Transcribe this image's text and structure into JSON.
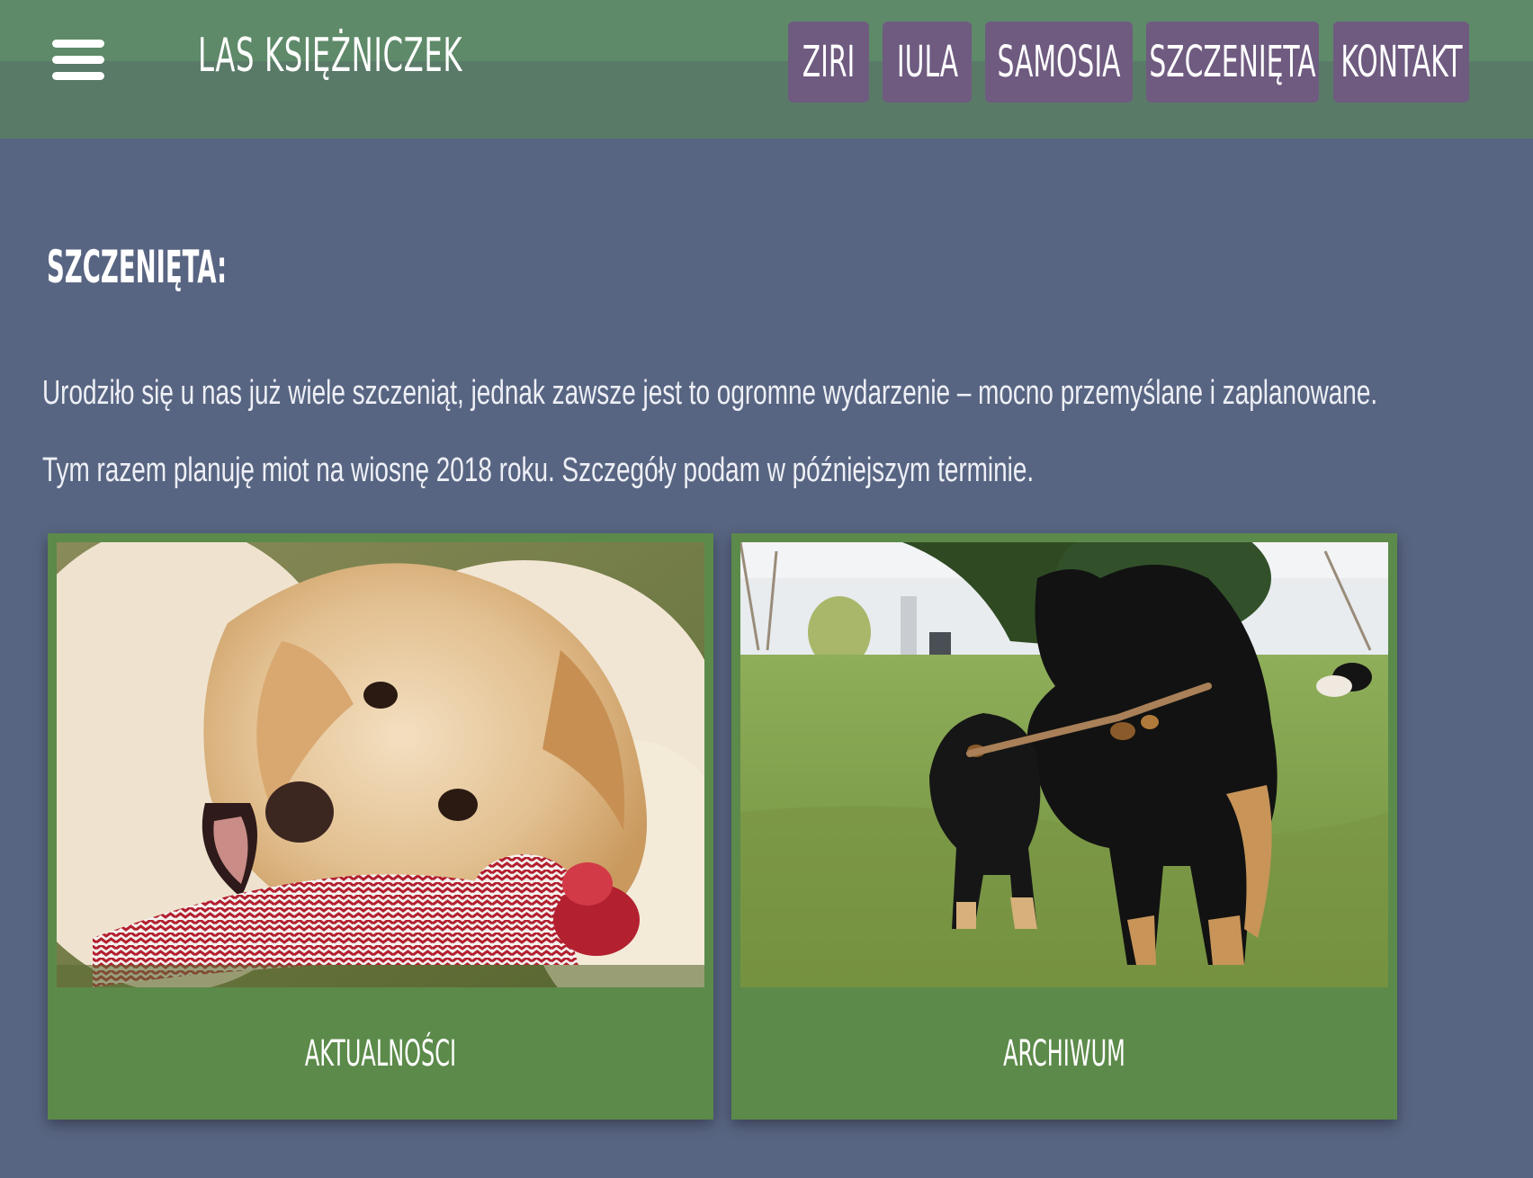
{
  "header": {
    "site_title": "LAS KSIĘŻNICZEK",
    "menu_icon": "hamburger-menu-icon",
    "nav": [
      {
        "label": "ZIRI"
      },
      {
        "label": "IULA"
      },
      {
        "label": "SAMOSIA"
      },
      {
        "label": "SZCZENIĘTA"
      },
      {
        "label": "KONTAKT"
      }
    ]
  },
  "main": {
    "heading": "SZCZENIĘTA:",
    "paragraphs": [
      "Urodziło się u nas już wiele szczeniąt, jednak zawsze jest to ogromne wydarzenie – mocno przemyślane i zaplanowane.",
      "Tym razem planuję miot na wiosnę 2018 roku. Szczegóły podam w późniejszym terminie."
    ],
    "cards": [
      {
        "label": "AKTUALNOŚCI",
        "image": "golden-puppy-chewing-rope-toy"
      },
      {
        "label": "ARCHIWUM",
        "image": "black-dog-and-puppy-with-stick"
      }
    ]
  },
  "colors": {
    "header_green": "#5e8a69",
    "nav_purple": "#6f5a80",
    "page_bg": "#586582",
    "card_green": "#5c8a4a"
  }
}
